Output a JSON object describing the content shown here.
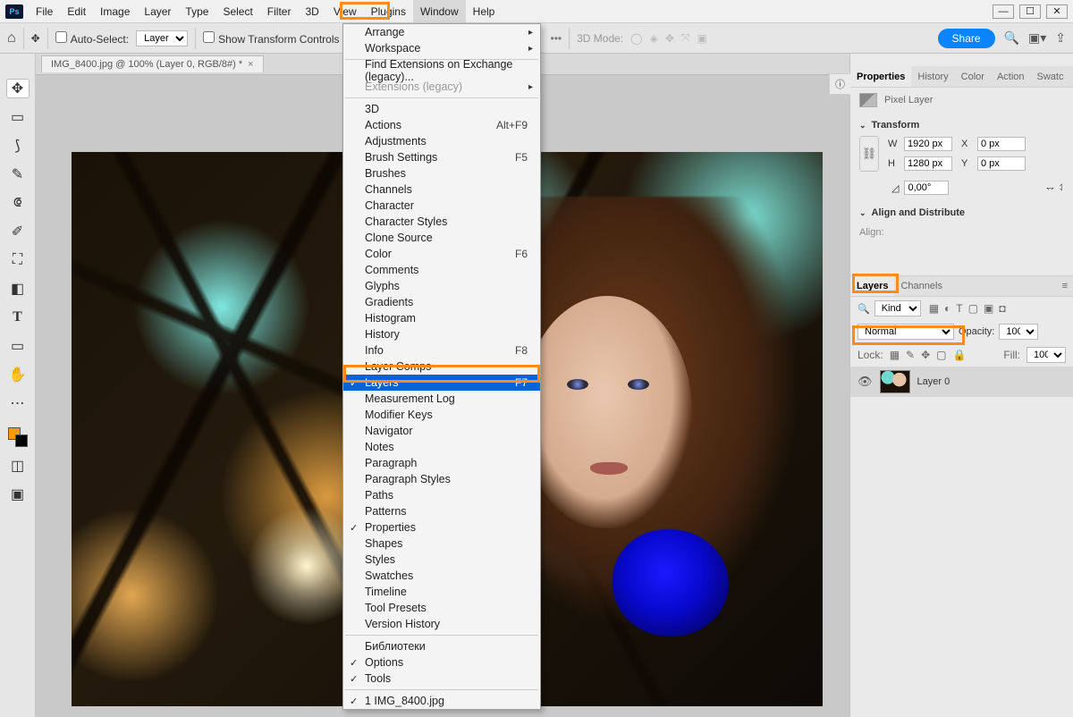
{
  "app_icon": "Ps",
  "menubar": [
    "File",
    "Edit",
    "Image",
    "Layer",
    "Type",
    "Select",
    "Filter",
    "3D",
    "View",
    "Plugins",
    "Window",
    "Help"
  ],
  "menubar_active": "Window",
  "window_controls": {
    "min": "—",
    "max": "☐",
    "close": "✕"
  },
  "optbar": {
    "auto_select": "Auto-Select:",
    "layer_sel": "Layer",
    "show_tc": "Show Transform Controls",
    "mode3d": "3D Mode:",
    "share": "Share"
  },
  "doc_tab": "IMG_8400.jpg @ 100% (Layer 0, RGB/8#) *",
  "dropdown": {
    "groups": [
      [
        {
          "label": "Arrange",
          "sub": true
        },
        {
          "label": "Workspace",
          "sub": true
        }
      ],
      [
        {
          "label": "Find Extensions on Exchange (legacy)..."
        },
        {
          "label": "Extensions (legacy)",
          "sub": true,
          "disabled": true
        }
      ],
      [
        {
          "label": "3D"
        },
        {
          "label": "Actions",
          "shortcut": "Alt+F9"
        },
        {
          "label": "Adjustments"
        },
        {
          "label": "Brush Settings",
          "shortcut": "F5"
        },
        {
          "label": "Brushes"
        },
        {
          "label": "Channels"
        },
        {
          "label": "Character"
        },
        {
          "label": "Character Styles"
        },
        {
          "label": "Clone Source"
        },
        {
          "label": "Color",
          "shortcut": "F6"
        },
        {
          "label": "Comments"
        },
        {
          "label": "Glyphs"
        },
        {
          "label": "Gradients"
        },
        {
          "label": "Histogram"
        },
        {
          "label": "History"
        },
        {
          "label": "Info",
          "shortcut": "F8"
        },
        {
          "label": "Layer Comps"
        },
        {
          "label": "Layers",
          "shortcut": "F7",
          "checked": true,
          "hov": true
        },
        {
          "label": "Measurement Log"
        },
        {
          "label": "Modifier Keys"
        },
        {
          "label": "Navigator"
        },
        {
          "label": "Notes"
        },
        {
          "label": "Paragraph"
        },
        {
          "label": "Paragraph Styles"
        },
        {
          "label": "Paths"
        },
        {
          "label": "Patterns"
        },
        {
          "label": "Properties",
          "checked": true
        },
        {
          "label": "Shapes"
        },
        {
          "label": "Styles"
        },
        {
          "label": "Swatches"
        },
        {
          "label": "Timeline"
        },
        {
          "label": "Tool Presets"
        },
        {
          "label": "Version History"
        }
      ],
      [
        {
          "label": "Библиотеки"
        },
        {
          "label": "Options",
          "checked": true
        },
        {
          "label": "Tools",
          "checked": true
        }
      ],
      [
        {
          "label": "1 IMG_8400.jpg",
          "checked": true
        }
      ]
    ]
  },
  "right": {
    "prop_tabs": [
      "Properties",
      "Historу",
      "Color",
      "Action",
      "Swatc"
    ],
    "pixel_layer": "Pixel Layer",
    "transform_title": "Transform",
    "W": "W",
    "H": "H",
    "X": "X",
    "Y": "Y",
    "w_val": "1920 px",
    "h_val": "1280 px",
    "x_val": "0 px",
    "y_val": "0 px",
    "angle": "0,00°",
    "align_title": "Align and Distribute",
    "align_label": "Align:",
    "layers_tabs": [
      "Layers",
      "Channels"
    ],
    "kind": "Kind",
    "blend": "Normal",
    "opacity_lbl": "Opacity:",
    "opacity_val": "100%",
    "lock_lbl": "Lock:",
    "fill_lbl": "Fill:",
    "fill_val": "100%",
    "layer0": "Layer 0"
  }
}
